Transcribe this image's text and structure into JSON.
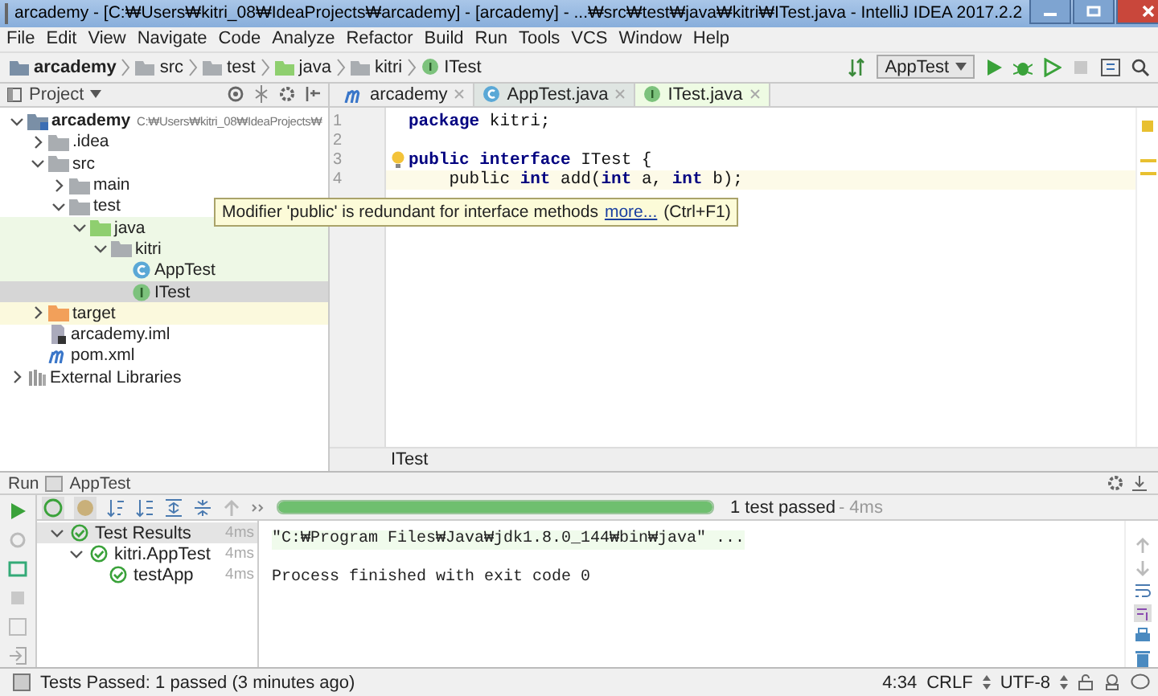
{
  "window": {
    "title": "arcademy - [C:₩Users₩kitri_08₩IdeaProjects₩arcademy] - [arcademy] - ...₩src₩test₩java₩kitri₩ITest.java - IntelliJ IDEA 2017.2.2"
  },
  "menu": [
    "File",
    "Edit",
    "View",
    "Navigate",
    "Code",
    "Analyze",
    "Refactor",
    "Build",
    "Run",
    "Tools",
    "VCS",
    "Window",
    "Help"
  ],
  "breadcrumbs": [
    {
      "label": "arcademy",
      "kind": "module"
    },
    {
      "label": "src",
      "kind": "folder"
    },
    {
      "label": "test",
      "kind": "folder"
    },
    {
      "label": "java",
      "kind": "test-folder"
    },
    {
      "label": "kitri",
      "kind": "package"
    },
    {
      "label": "ITest",
      "kind": "interface"
    }
  ],
  "run_config": "AppTest",
  "project_panel": {
    "title": "Project"
  },
  "project_tree": [
    {
      "label": "arcademy",
      "path": "C:₩Users₩kitri_08₩IdeaProjects₩",
      "kind": "module",
      "expanded": true,
      "selected": false,
      "children": [
        {
          "label": ".idea",
          "kind": "folder",
          "expanded": false,
          "selected": false
        },
        {
          "label": "src",
          "kind": "folder",
          "expanded": true,
          "selected": false,
          "children": [
            {
              "label": "main",
              "kind": "folder",
              "expanded": false,
              "selected": false
            },
            {
              "label": "test",
              "kind": "folder",
              "expanded": true,
              "selected": false,
              "children": [
                {
                  "label": "java",
                  "kind": "test-folder",
                  "test_source": true,
                  "expanded": true,
                  "selected": false,
                  "children": [
                    {
                      "label": "kitri",
                      "kind": "package",
                      "test_source": true,
                      "expanded": true,
                      "selected": false,
                      "children": [
                        {
                          "label": "AppTest",
                          "kind": "class",
                          "test_source": true,
                          "selected": false
                        },
                        {
                          "label": "ITest",
                          "kind": "interface",
                          "test_source": true,
                          "selected": true
                        }
                      ]
                    }
                  ]
                }
              ]
            }
          ]
        },
        {
          "label": "target",
          "kind": "excluded-folder",
          "excluded": true,
          "expanded": false,
          "selected": false
        },
        {
          "label": "arcademy.iml",
          "kind": "module-file",
          "selected": false
        },
        {
          "label": "pom.xml",
          "kind": "maven-file",
          "selected": false
        }
      ]
    },
    {
      "label": "External Libraries",
      "kind": "libraries",
      "expanded": false,
      "selected": false
    }
  ],
  "editor_tabs": [
    {
      "label": "arcademy",
      "kind": "maven-file",
      "selected": false
    },
    {
      "label": "AppTest.java",
      "kind": "class",
      "selected": false
    },
    {
      "label": "ITest.java",
      "kind": "interface",
      "selected": true
    }
  ],
  "code_lines": [
    {
      "number": "1",
      "text": "**package** kitri;",
      "current": false
    },
    {
      "number": "2",
      "current": false
    },
    {
      "number": "3",
      "text": "**public interface** ITest {",
      "current": false
    },
    {
      "number": "4",
      "text": "    public **int** add(**int** a, **int** b);",
      "current": true
    }
  ],
  "tooltip": {
    "text": "Modifier 'public' is redundant for interface methods",
    "link": "more...",
    "shortcut": "(Ctrl+F1)"
  },
  "editor_breadcrumb": "ITest",
  "run_panel": {
    "label": "Run",
    "config": "AppTest"
  },
  "test_progress": {
    "level": 1,
    "summary": "1 test passed",
    "time": "- 4ms"
  },
  "test_tree": [
    {
      "label": "Test Results",
      "time": "4ms",
      "selected": true,
      "children": [
        {
          "label": "kitri.AppTest",
          "time": "4ms",
          "selected": false,
          "children": [
            {
              "label": "testApp",
              "time": "4ms",
              "selected": false
            }
          ]
        }
      ]
    }
  ],
  "console": [
    {
      "text": "\"C:₩Program Files₩Java₩jdk1.8.0_144₩bin₩java\" ...",
      "kind": "command"
    },
    {
      "kind": "blank"
    },
    {
      "text": "Process finished with exit code 0",
      "kind": "output"
    }
  ],
  "status_bar": {
    "message": "Tests Passed: 1 passed (3 minutes ago)",
    "position": "4:34",
    "line_separator": "CRLF",
    "encoding": "UTF-8"
  }
}
